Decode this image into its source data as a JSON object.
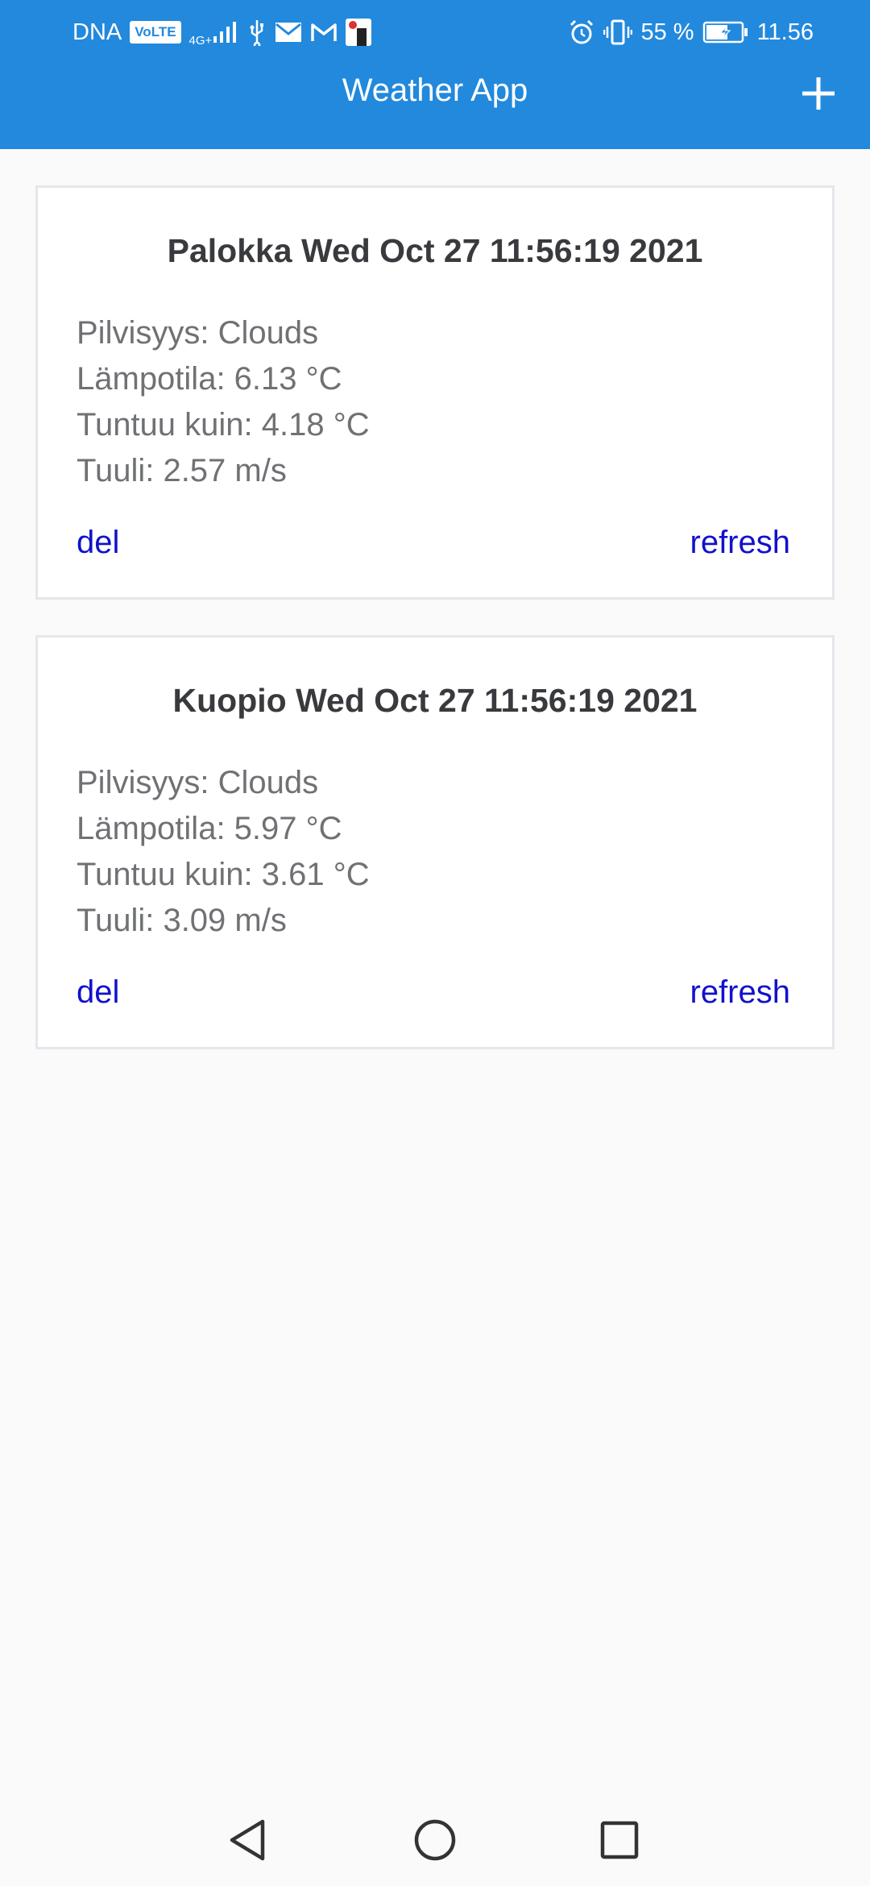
{
  "status_bar": {
    "carrier": "DNA",
    "volte_badge": "VoLTE",
    "network": "4G+",
    "battery_percent": "55 %",
    "time": "11.56",
    "icons": [
      "signal-icon",
      "usb-icon",
      "mail-icon",
      "gmail-icon",
      "app-notification-icon",
      "alarm-icon",
      "vibrate-icon",
      "battery-charging-icon"
    ]
  },
  "app_bar": {
    "title": "Weather App",
    "add_icon": "plus-icon"
  },
  "cards": [
    {
      "title": "Palokka Wed Oct 27 11:56:19 2021",
      "cloudiness": "Pilvisyys: Clouds",
      "temperature": "Lämpotila: 6.13 °C",
      "feels_like": "Tuntuu kuin: 4.18 °C",
      "wind": "Tuuli: 2.57 m/s",
      "del_label": "del",
      "refresh_label": "refresh"
    },
    {
      "title": "Kuopio Wed Oct 27 11:56:19 2021",
      "cloudiness": "Pilvisyys: Clouds",
      "temperature": "Lämpotila: 5.97 °C",
      "feels_like": "Tuntuu kuin: 3.61 °C",
      "wind": "Tuuli: 3.09 m/s",
      "del_label": "del",
      "refresh_label": "refresh"
    }
  ],
  "nav_bar": {
    "icons": [
      "back-triangle-icon",
      "home-circle-icon",
      "recents-square-icon"
    ]
  },
  "colors": {
    "app_bar": "#2289dd",
    "link": "#1111cc",
    "title_text": "#383a3d",
    "body_text": "#6f7174",
    "background": "#fafafa"
  }
}
